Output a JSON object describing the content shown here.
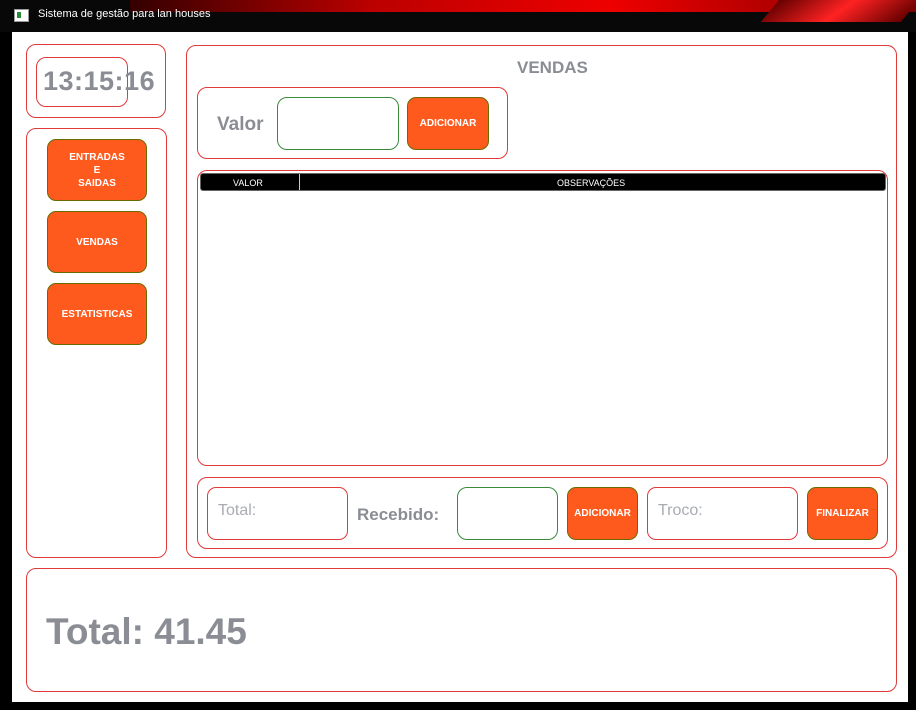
{
  "window": {
    "title": "Sistema de gestão para lan houses"
  },
  "clock": {
    "time": "13:15:16"
  },
  "sidebar": {
    "buttons": [
      {
        "label": "ENTRADAS\nE\nSAIDAS"
      },
      {
        "label": "VENDAS"
      },
      {
        "label": "ESTATISTICAS"
      }
    ]
  },
  "sales": {
    "title": "VENDAS",
    "valor_label": "Valor",
    "valor_value": "",
    "add_label": "ADICIONAR",
    "table": {
      "columns": [
        "VALOR",
        "OBSERVAÇÕES"
      ],
      "rows": []
    },
    "footer": {
      "total_placeholder": "Total:",
      "recebido_label": "Recebido:",
      "recebido_value": "",
      "add_label": "ADICIONAR",
      "troco_placeholder": "Troco:",
      "finalize_label": "FINALIZAR"
    }
  },
  "summary": {
    "total_text": "Total: 41.45"
  },
  "colors": {
    "accent": "#ff5a1e",
    "border": "#e03a3a",
    "text_grey": "#8a8d94"
  }
}
